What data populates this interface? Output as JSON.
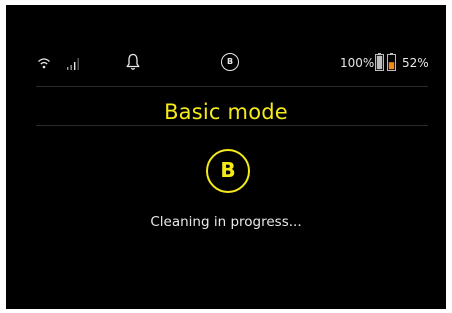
{
  "status_bar": {
    "wifi_icon": "wifi-icon",
    "signal_icon": "signal-bars-icon",
    "notification_icon": "bell-icon",
    "mode_badge": "B",
    "battery_1_percent": "100%",
    "battery_1_level": 1.0,
    "battery_2_percent": "52%",
    "battery_2_level": 0.52
  },
  "main": {
    "title": "Basic mode",
    "mode_badge": "B",
    "status_text": "Cleaning in progress..."
  },
  "colors": {
    "background": "#000000",
    "accent": "#f5ea1a",
    "text": "#e8e8e8",
    "battery_low": "#f08a1c"
  }
}
